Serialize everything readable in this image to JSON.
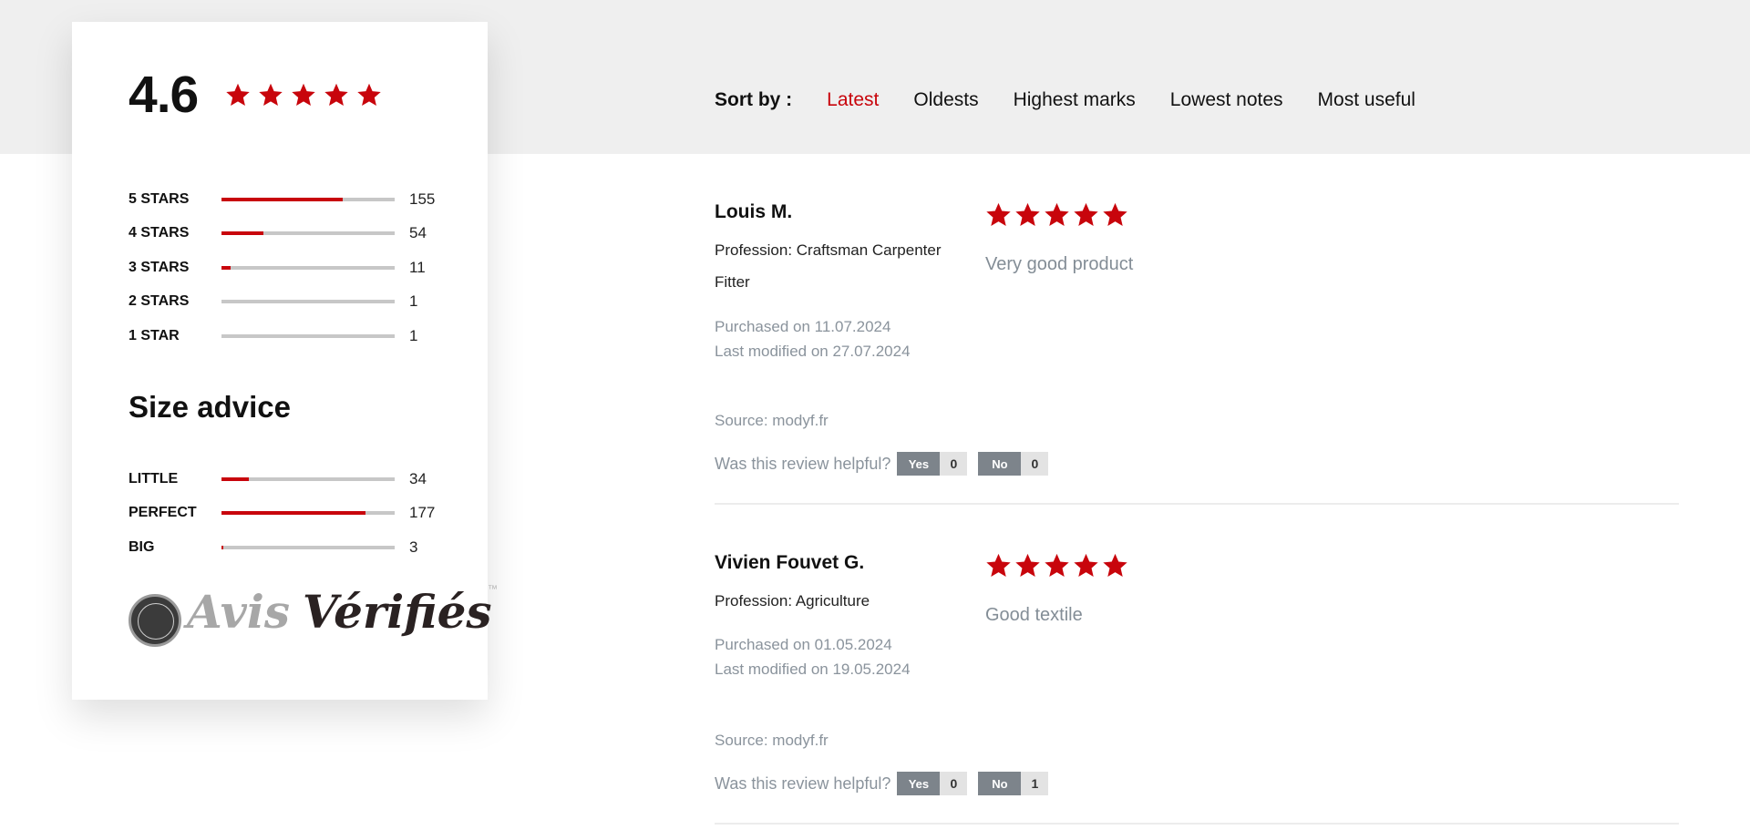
{
  "summary": {
    "average": "4.6",
    "average_stars": 5,
    "distribution": [
      {
        "label": "5 STARS",
        "count": "155",
        "fill": 0.7
      },
      {
        "label": "4 STARS",
        "count": "54",
        "fill": 0.24
      },
      {
        "label": "3 STARS",
        "count": "11",
        "fill": 0.05
      },
      {
        "label": "2 STARS",
        "count": "1",
        "fill": 0.0
      },
      {
        "label": "1 STAR",
        "count": "1",
        "fill": 0.0
      }
    ]
  },
  "size_advice": {
    "title": "Size advice",
    "items": [
      {
        "label": "LITTLE",
        "count": "34",
        "fill": 0.16
      },
      {
        "label": "PERFECT",
        "count": "177",
        "fill": 0.83
      },
      {
        "label": "BIG",
        "count": "3",
        "fill": 0.01
      }
    ]
  },
  "logo": {
    "part1": "Avis",
    "part2": "Vérifiés",
    "tm": "™"
  },
  "sort": {
    "label": "Sort by :",
    "options": [
      "Latest",
      "Oldests",
      "Highest marks",
      "Lowest notes",
      "Most useful"
    ],
    "active": "Latest"
  },
  "reviews": [
    {
      "name": "Louis M.",
      "profession": "Profession: Craftsman Carpenter Fitter",
      "purchased": "Purchased on 11.07.2024",
      "modified": "Last modified on 27.07.2024",
      "rating": 5,
      "comment": "Very good product",
      "source": "Source: modyf.fr",
      "helpful_prompt": "Was this review helpful?",
      "yes_label": "Yes",
      "yes_count": "0",
      "no_label": "No",
      "no_count": "0"
    },
    {
      "name": "Vivien Fouvet G.",
      "profession": "Profession: Agriculture",
      "purchased": "Purchased on 01.05.2024",
      "modified": "Last modified on 19.05.2024",
      "rating": 5,
      "comment": "Good textile",
      "source": "Source: modyf.fr",
      "helpful_prompt": "Was this review helpful?",
      "yes_label": "Yes",
      "yes_count": "0",
      "no_label": "No",
      "no_count": "1"
    }
  ],
  "colors": {
    "accent": "#c8050c",
    "muted": "#8a939c"
  }
}
